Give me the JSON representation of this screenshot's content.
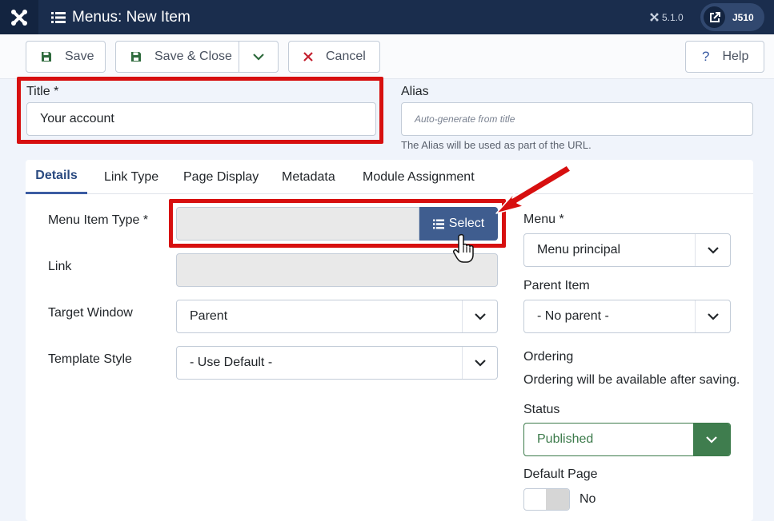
{
  "header": {
    "title": "Menus: New Item",
    "version": "5.1.0",
    "user_label": "J510"
  },
  "toolbar": {
    "save_label": "Save",
    "save_close_label": "Save & Close",
    "cancel_label": "Cancel",
    "help_label": "Help"
  },
  "form": {
    "title_label": "Title *",
    "title_value": "Your account",
    "alias_label": "Alias",
    "alias_placeholder": "Auto-generate from title",
    "alias_hint": "The Alias will be used as part of the URL."
  },
  "tabs": [
    "Details",
    "Link Type",
    "Page Display",
    "Metadata",
    "Module Assignment"
  ],
  "details": {
    "menu_item_type_label": "Menu Item Type *",
    "select_label": "Select",
    "link_label": "Link",
    "target_window_label": "Target Window",
    "target_window_value": "Parent",
    "template_style_label": "Template Style",
    "template_style_value": "- Use Default -"
  },
  "sidebar": {
    "menu_label": "Menu *",
    "menu_value": "Menu principal",
    "parent_label": "Parent Item",
    "parent_value": "- No parent -",
    "ordering_label": "Ordering",
    "ordering_text": "Ordering will be available after saving.",
    "status_label": "Status",
    "status_value": "Published",
    "default_page_label": "Default Page",
    "default_page_value": "No"
  },
  "colors": {
    "header_bg": "#1a2d4d",
    "highlight": "#d70f0f",
    "accent": "#3f5d8f",
    "status_green": "#3f7d4e"
  },
  "icons": [
    "joomla-logo-icon",
    "list-icon",
    "external-link-icon",
    "save-icon",
    "chevron-down-icon",
    "close-icon",
    "help-icon",
    "pointer-hand-icon",
    "arrow-annotation-icon"
  ]
}
